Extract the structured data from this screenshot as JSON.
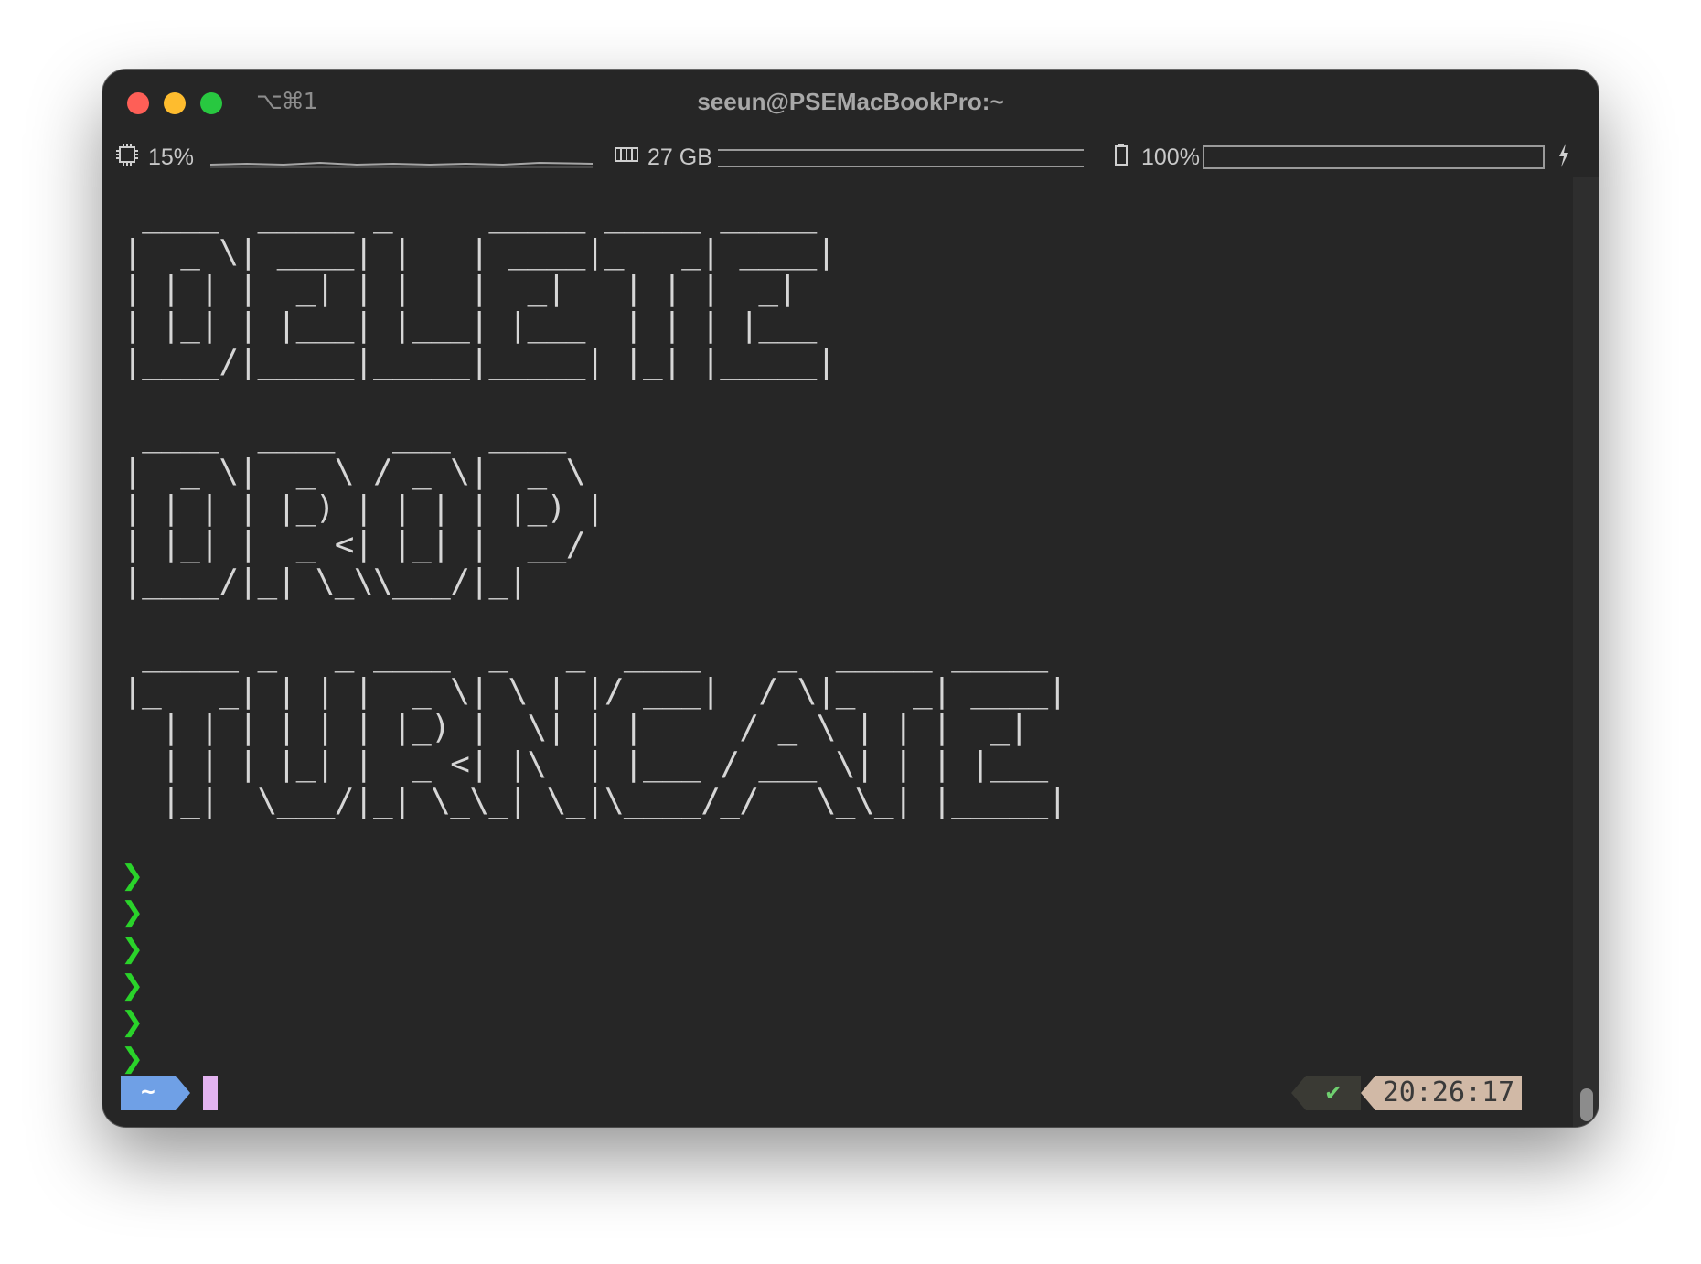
{
  "window": {
    "title": "seeun@PSEMacBookPro:~",
    "shortcut": "⌥⌘1"
  },
  "status": {
    "cpu_label": "15%",
    "cpu_percent": 15,
    "memory_label": "27 GB",
    "battery_label": "100%",
    "battery_percent": 100,
    "cpu_icon": "cpu-chip-icon",
    "memory_icon": "memory-icon",
    "battery_icon": "battery-icon",
    "charging_icon": "lightning-bolt-icon"
  },
  "terminal": {
    "banners": [
      " ____  _____ _     _____ _____ _____ \n|  _ \\| ____| |   | ____|_   _| ____|\n| | | |  _| | |   |  _|   | | |  _|  \n| |_| | |___| |___| |___  | | | |___ \n|____/|_____|_____|_____| |_| |_____|",
      " ____  ____   ___  ____  \n|  _ \\|  _ \\ / _ \\|  _ \\ \n| | | | |_) | | | | |_) |\n| |_| |  _ <| |_| |  __/ \n|____/|_| \\_\\\\___/|_|    ",
      " _____ _   _ ____  _   _  ____    _  _____ _____ \n|_   _| | | |  _ \\| \\ | |/ ___|  / \\|_   _| ____|\n  | | | | | | |_) |  \\| | |     / _ \\ | | |  _|  \n  | | | |_| |  _ <| |\\  | |___ / ___ \\| | | |___ \n  |_|  \\___/|_| \\_\\_| \\_|\\____/_/   \\_\\_| |_____|"
    ],
    "prompt_symbol": "❯",
    "prompt_count": 6,
    "dir_label": "~",
    "status_check": "✔",
    "time": "20:26:17"
  },
  "colors": {
    "terminal_bg": "#262626",
    "prompt_green": "#2ad32a",
    "dir_blue": "#6fa0e6",
    "cursor_pink": "#e3b3f0",
    "time_bg": "#d1b9a6"
  }
}
